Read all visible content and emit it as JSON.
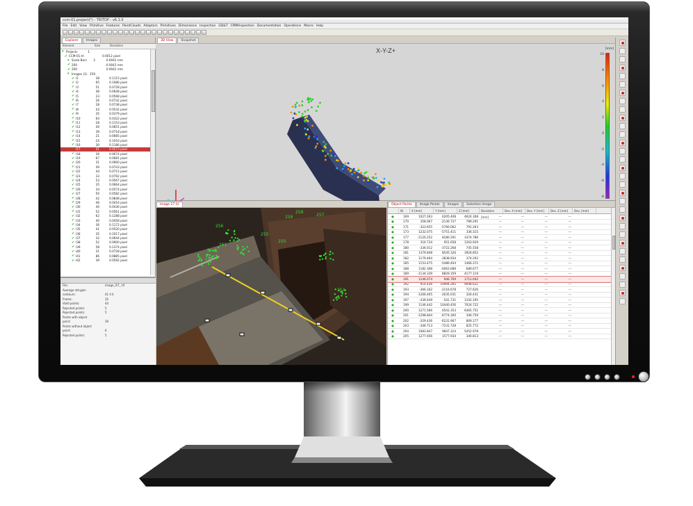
{
  "window": {
    "title": "ccm-01.project(*) - TRITOP - v6.1.0"
  },
  "menu": [
    "File",
    "Edit",
    "View",
    "Primitive",
    "Features",
    "PointClouds",
    "Adaptors",
    "Primitives",
    "Dimensions",
    "Inspection",
    "GD&T",
    "CMMInspection",
    "Documentation",
    "Operations",
    "Macro",
    "Help"
  ],
  "left_tabs": [
    "Explorer",
    "Images"
  ],
  "tree_head": {
    "name": "Element",
    "size": "Size",
    "deviation": "Deviation"
  },
  "tree": [
    {
      "name": "Projects",
      "n": "1",
      "v": ""
    },
    {
      "name": "CCM-01.tri",
      "n": "",
      "v": "0.0012 pixel"
    },
    {
      "name": "Scale Bars",
      "n": "2",
      "v": "0.0042 mm"
    },
    {
      "name": "200",
      "n": "",
      "v": "-0.0042 mm"
    },
    {
      "name": "200",
      "n": "",
      "v": "0.0042 mm"
    },
    {
      "name": "Images (1)",
      "n": "259",
      "v": ""
    },
    {
      "name": "I1",
      "n": "38",
      "v": "0.1115 pixel"
    },
    {
      "name": "I2",
      "n": "65",
      "v": "0.1086 pixel"
    },
    {
      "name": "I3",
      "n": "51",
      "v": "0.0728 pixel"
    },
    {
      "name": "I4",
      "n": "48",
      "v": "0.0648 pixel"
    },
    {
      "name": "I5",
      "n": "23",
      "v": "0.0568 pixel"
    },
    {
      "name": "I6",
      "n": "26",
      "v": "0.0732 pixel"
    },
    {
      "name": "I7",
      "n": "28",
      "v": "0.0738 pixel"
    },
    {
      "name": "I8",
      "n": "43",
      "v": "0.0532 pixel"
    },
    {
      "name": "I9",
      "n": "35",
      "v": "0.0379 pixel"
    },
    {
      "name": "I10",
      "n": "64",
      "v": "0.0322 pixel"
    },
    {
      "name": "I11",
      "n": "28",
      "v": "0.1153 pixel"
    },
    {
      "name": "I12",
      "n": "40",
      "v": "0.0651 pixel"
    },
    {
      "name": "I13",
      "n": "39",
      "v": "0.0718 pixel"
    },
    {
      "name": "I14",
      "n": "21",
      "v": "0.0685 pixel"
    },
    {
      "name": "I15",
      "n": "24",
      "v": "0.1016 pixel"
    },
    {
      "name": "I16",
      "n": "30",
      "v": "0.1186 pixel"
    },
    {
      "name": "I17",
      "n": "41",
      "v": "0.0573 pixel",
      "sel": true
    },
    {
      "name": "I18",
      "n": "36",
      "v": "0.0674 pixel"
    },
    {
      "name": "I19",
      "n": "67",
      "v": "0.0681 pixel"
    },
    {
      "name": "I20",
      "n": "31",
      "v": "0.0660 pixel"
    },
    {
      "name": "I21",
      "n": "49",
      "v": "0.0743 pixel"
    },
    {
      "name": "I22",
      "n": "44",
      "v": "0.0715 pixel"
    },
    {
      "name": "I23",
      "n": "33",
      "v": "0.0792 pixel"
    },
    {
      "name": "I24",
      "n": "53",
      "v": "0.0567 pixel"
    },
    {
      "name": "I25",
      "n": "35",
      "v": "0.0664 pixel"
    },
    {
      "name": "I26",
      "n": "34",
      "v": "0.0574 pixel"
    },
    {
      "name": "I27",
      "n": "50",
      "v": "0.0582 pixel"
    },
    {
      "name": "I28",
      "n": "42",
      "v": "0.0848 pixel"
    },
    {
      "name": "I29",
      "n": "46",
      "v": "0.0416 pixel"
    },
    {
      "name": "I30",
      "n": "40",
      "v": "0.0436 pixel"
    },
    {
      "name": "I31",
      "n": "52",
      "v": "0.0561 pixel"
    },
    {
      "name": "I32",
      "n": "62",
      "v": "0.1288 pixel"
    },
    {
      "name": "I33",
      "n": "40",
      "v": "0.0458 pixel"
    },
    {
      "name": "I34",
      "n": "36",
      "v": "0.1172 pixel"
    },
    {
      "name": "I35",
      "n": "41",
      "v": "0.0520 pixel"
    },
    {
      "name": "I36",
      "n": "35",
      "v": "0.1017 pixel"
    },
    {
      "name": "I37",
      "n": "32",
      "v": "0.0644 pixel"
    },
    {
      "name": "I38",
      "n": "52",
      "v": "0.0600 pixel"
    },
    {
      "name": "I39",
      "n": "58",
      "v": "0.1374 pixel"
    },
    {
      "name": "I40",
      "n": "31",
      "v": "0.0728 pixel"
    },
    {
      "name": "I41",
      "n": "86",
      "v": "0.0885 pixel"
    },
    {
      "name": "I42",
      "n": "39",
      "v": "0.0592 pixel"
    }
  ],
  "props": [
    {
      "k": "File:",
      "v": "image_I17_.tif"
    },
    {
      "k": "Average  std.gain",
      "v": ""
    },
    {
      "k": "contours:",
      "v": "41  4  4"
    },
    {
      "k": "Frame:",
      "v": "35"
    },
    {
      "k": "Valid points:",
      "v": "44"
    },
    {
      "k": "Rejected points:",
      "v": "5"
    },
    {
      "k": "Rejected points:",
      "v": "5"
    },
    {
      "k": "Points with object",
      "v": ""
    },
    {
      "k": "point:",
      "v": "39"
    },
    {
      "k": "Points without object",
      "v": ""
    },
    {
      "k": "point:",
      "v": "6"
    },
    {
      "k": "Rejected points:",
      "v": "5"
    }
  ],
  "view3d": {
    "tabs": [
      "3D View",
      "Snapshot"
    ],
    "title": "X-Y-Z+",
    "unit": "[mm]",
    "ticks": [
      "10",
      "8",
      "6",
      "4",
      "2",
      "0",
      "-2",
      "-4",
      "-6",
      "-8"
    ]
  },
  "image_panel": {
    "tab": "Image 17 (I)",
    "labels": [
      "257",
      "259",
      "256",
      "252",
      "250",
      "258",
      "261",
      "255",
      "254"
    ]
  },
  "table": {
    "tabs": [
      "Object Points",
      "Image Points",
      "Images",
      "Selection Image"
    ],
    "headers": [
      "",
      "ID",
      "X [mm]",
      "Y [mm]",
      "Z [mm]",
      "Deviation [mm]",
      "Dev. X [mm]",
      "Dev. Y [mm]",
      "Dev. Z [mm]",
      "Dev. [mm]"
    ],
    "rows": [
      [
        "169",
        "1027.263",
        "6205.408",
        "4624.308",
        "---",
        "---",
        "---",
        "---"
      ],
      [
        "170",
        "358.067",
        "-2136.727",
        "789.291",
        "---",
        "---",
        "---",
        "---"
      ],
      [
        "171",
        "-323.655",
        "-5760.062",
        "791.263",
        "---",
        "---",
        "---",
        "---"
      ],
      [
        "173",
        "1232.075",
        "-5751.411",
        "336.315",
        "---",
        "---",
        "---",
        "---"
      ],
      [
        "177",
        "-1120.252",
        "8180.291",
        "3374.786",
        "---",
        "---",
        "---",
        "---"
      ],
      [
        "178",
        "316.734",
        "951.658",
        "1263.929",
        "---",
        "---",
        "---",
        "---"
      ],
      [
        "180",
        "-336.012",
        "-3722.268",
        "745.558",
        "---",
        "---",
        "---",
        "---"
      ],
      [
        "181",
        "1379.848",
        "8545.326",
        "3926.852",
        "---",
        "---",
        "---",
        "---"
      ],
      [
        "182",
        "1179.464",
        "-3838.934",
        "374.292",
        "---",
        "---",
        "---",
        "---"
      ],
      [
        "185",
        "1153.475",
        "-5486.404",
        "1466.372",
        "---",
        "---",
        "---",
        "---"
      ],
      [
        "188",
        "1182.308",
        "-6063.689",
        "689.677",
        "---",
        "---",
        "---",
        "---"
      ],
      [
        "189",
        "-1134.339",
        "8829.359",
        "4177.119",
        "---",
        "---",
        "---",
        "---"
      ],
      [
        "191",
        "1146.074",
        "946.769",
        "1712.042",
        "---",
        "---",
        "---",
        "---"
      ],
      [
        "192",
        "914.436",
        "10994.265",
        "9048.621",
        "---",
        "---",
        "---",
        "---"
      ],
      [
        "193",
        "-366.162",
        "-2116.678",
        "727.626",
        "---",
        "---",
        "---",
        "---"
      ],
      [
        "194",
        "-1266.405",
        "-2635.031",
        "326.431",
        "---",
        "---",
        "---",
        "---"
      ],
      [
        "197",
        "-439.449",
        "-541.731",
        "1102.195",
        "---",
        "---",
        "---",
        "---"
      ],
      [
        "199",
        "1146.442",
        "10440.456",
        "7024.722",
        "---",
        "---",
        "---",
        "---"
      ],
      [
        "200",
        "1271.566",
        "6541.353",
        "6465.751",
        "---",
        "---",
        "---",
        "---"
      ],
      [
        "201",
        "-1298.844",
        "-6774.300",
        "346.759",
        "---",
        "---",
        "---",
        "---"
      ],
      [
        "202",
        "-329.436",
        "-6231.967",
        "809.177",
        "---",
        "---",
        "---",
        "---"
      ],
      [
        "203",
        "-346.713",
        "-7231.728",
        "825.772",
        "---",
        "---",
        "---",
        "---"
      ],
      [
        "204",
        "1083.847",
        "9847.314",
        "5452.978",
        "---",
        "---",
        "---",
        "---"
      ],
      [
        "205",
        "1277.656",
        "1577.934",
        "340.813",
        "---",
        "---",
        "---",
        "---"
      ]
    ],
    "highlight_index": 12
  },
  "colors": {
    "accent": "#c83a3a",
    "check": "#22aa22",
    "photo_marker": "#33dd33",
    "bar": "#f0d020"
  }
}
